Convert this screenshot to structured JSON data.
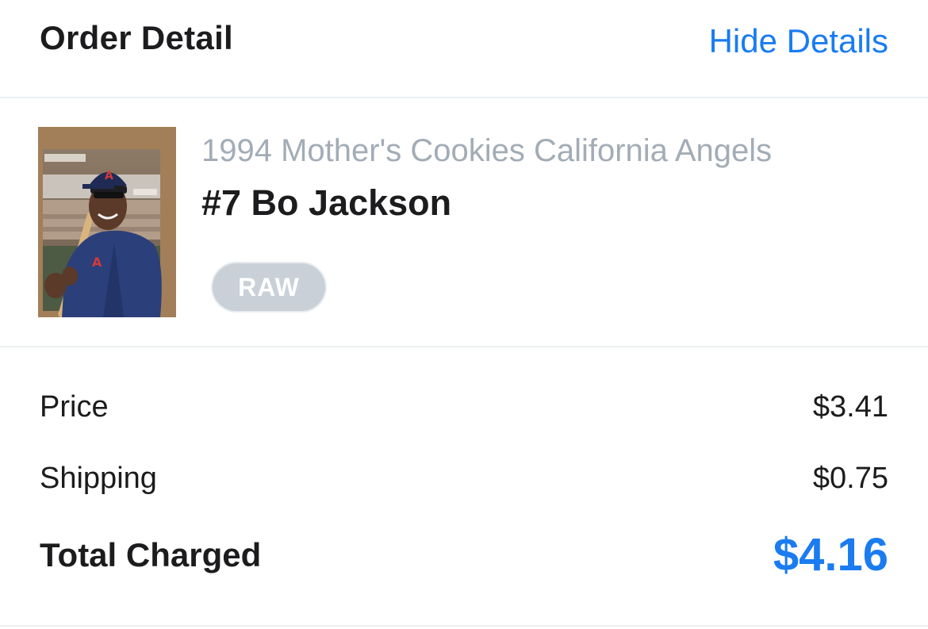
{
  "header": {
    "title": "Order Detail",
    "toggle_label": "Hide Details"
  },
  "item": {
    "set_name": "1994 Mother's Cookies California Angels",
    "card_name": "#7 Bo Jackson",
    "condition_badge": "RAW",
    "thumbnail_icon": "baseball-card-photo"
  },
  "summary": {
    "price_label": "Price",
    "price_value": "$3.41",
    "shipping_label": "Shipping",
    "shipping_value": "$0.75",
    "total_label": "Total Charged",
    "total_value": "$4.16"
  },
  "colors": {
    "accent": "#1a7cf0",
    "muted_text": "#a3acb6",
    "badge_bg": "#c9d0d7",
    "divider": "#eceff2"
  }
}
